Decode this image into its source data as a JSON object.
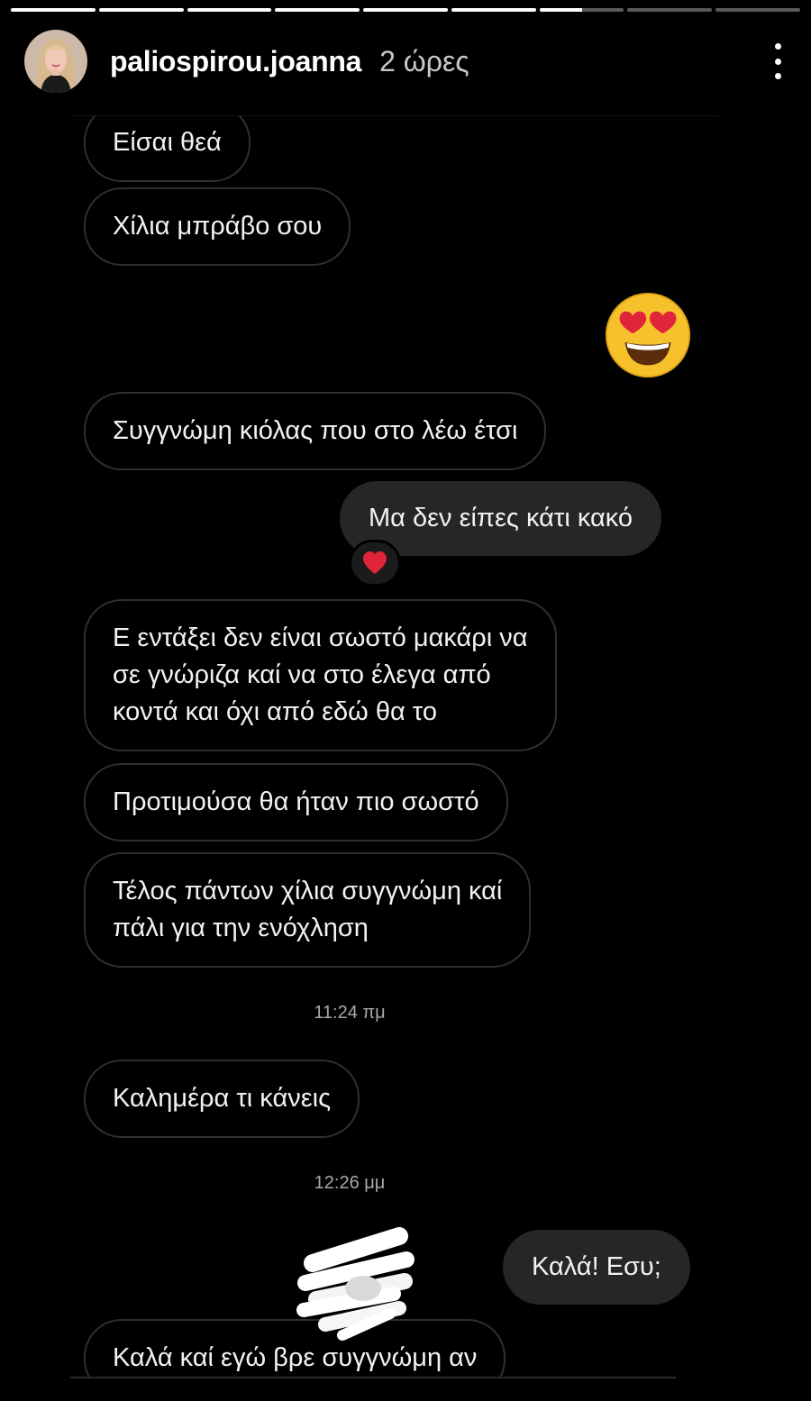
{
  "story": {
    "segments": [
      1,
      1,
      1,
      1,
      1,
      1,
      0.5,
      0,
      0
    ],
    "username": "paliospirou.joanna",
    "time_ago": "2 ώρες"
  },
  "chat": {
    "messages": [
      {
        "side": "in",
        "text": "Είσαι θεά"
      },
      {
        "side": "in",
        "text": "Χίλια μπράβο σου"
      },
      {
        "side": "out",
        "type": "emoji",
        "emoji": "heart-eyes-emoji"
      },
      {
        "side": "in",
        "text": "Συγγνώμη κιόλας που στο λέω έτσι"
      },
      {
        "side": "out",
        "text": "Μα δεν είπες κάτι κακό",
        "reaction": "red-heart"
      },
      {
        "side": "in",
        "lines": [
          "Ε  εντάξει δεν είναι σωστό μακάρι να",
          "σε γνώριζα καί να στο έλεγα από",
          "κοντά και όχι από εδώ θα το"
        ]
      },
      {
        "side": "in",
        "text": "Προτιμούσα θα ήταν πιο σωστό"
      },
      {
        "side": "in",
        "lines": [
          "Τέλος πάντων χίλια συγγνώμη καί",
          "πάλι για την ενόχληση"
        ]
      },
      {
        "type": "timestamp",
        "text": "11:24 πμ"
      },
      {
        "side": "in",
        "text": "Καλημέρα τι κάνεις"
      },
      {
        "type": "timestamp",
        "text": "12:26 μμ"
      },
      {
        "side": "out",
        "text": "Καλά! Εσυ;"
      },
      {
        "side": "in",
        "text": "Καλά καί εγώ βρε συγγνώμη αν"
      }
    ]
  },
  "colors": {
    "background": "#000000",
    "incoming_border": "#2f2f2f",
    "outgoing_bubble": "#262626",
    "reaction_heart": "#e0243a",
    "emoji_yellow": "#f7c12c"
  }
}
